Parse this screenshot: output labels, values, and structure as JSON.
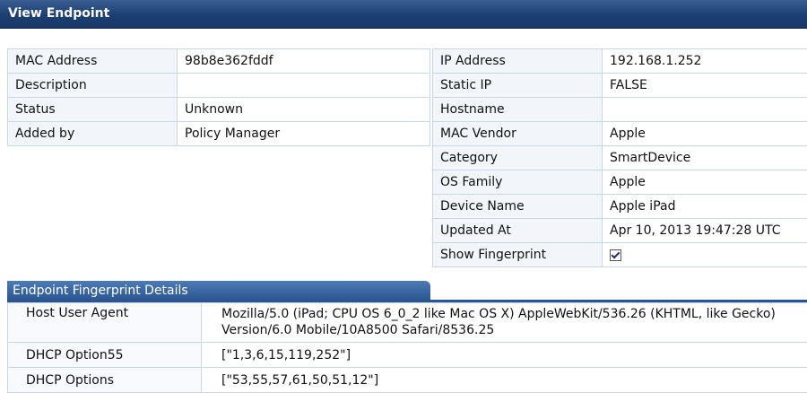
{
  "window": {
    "title": "View Endpoint"
  },
  "left": [
    {
      "label": "MAC Address",
      "value": "98b8e362fddf"
    },
    {
      "label": "Description",
      "value": ""
    },
    {
      "label": "Status",
      "value": "Unknown"
    },
    {
      "label": "Added by",
      "value": "Policy Manager"
    }
  ],
  "right": [
    {
      "label": "IP Address",
      "value": "192.168.1.252"
    },
    {
      "label": "Static IP",
      "value": "FALSE"
    },
    {
      "label": "Hostname",
      "value": ""
    },
    {
      "label": "MAC Vendor",
      "value": "Apple"
    },
    {
      "label": "Category",
      "value": "SmartDevice"
    },
    {
      "label": "OS Family",
      "value": "Apple"
    },
    {
      "label": "Device Name",
      "value": "Apple iPad"
    },
    {
      "label": "Updated At",
      "value": "Apr 10, 2013 19:47:28 UTC"
    },
    {
      "label": "Show Fingerprint",
      "checked": true
    }
  ],
  "fingerprint": {
    "title": "Endpoint Fingerprint Details",
    "rows": [
      {
        "label": "Host User Agent",
        "value": "Mozilla/5.0 (iPad; CPU OS 6_0_2 like Mac OS X) AppleWebKit/536.26 (KHTML, like Gecko) Version/6.0 Mobile/10A8500 Safari/8536.25"
      },
      {
        "label": "DHCP Option55",
        "value": "[\"1,3,6,15,119,252\"]"
      },
      {
        "label": "DHCP Options",
        "value": "[\"53,55,57,61,50,51,12\"]"
      }
    ]
  }
}
